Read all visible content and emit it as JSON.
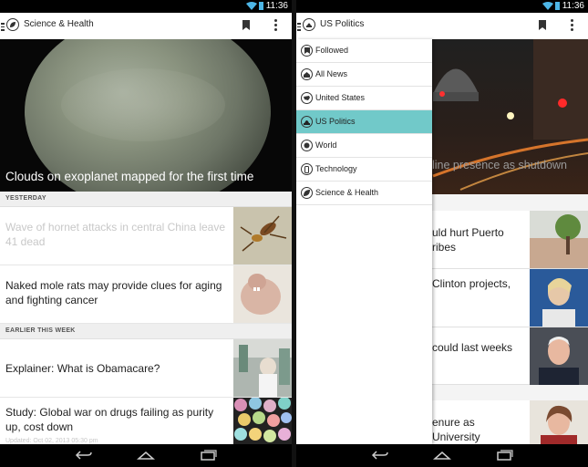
{
  "status": {
    "time": "11:36"
  },
  "left": {
    "appbar": {
      "title": "Science & Health"
    },
    "hero": {
      "caption": "Clouds on exoplanet mapped for the first time"
    },
    "sections": [
      "YESTERDAY",
      "EARLIER THIS WEEK"
    ],
    "stories": [
      {
        "headline": "Wave of hornet attacks in central China leave 41 dead",
        "read": true
      },
      {
        "headline": "Naked mole rats may provide clues for aging and fighting cancer",
        "read": false
      },
      {
        "headline": "Explainer: What is Obamacare?",
        "read": false
      },
      {
        "headline": "Study: Global war on drugs failing as purity up, cost down",
        "read": false,
        "meta": "Updated: Oct 02, 2013 05:30 pm"
      }
    ]
  },
  "right": {
    "appbar": {
      "title": "US Politics"
    },
    "drawer": {
      "items": [
        {
          "label": "Followed",
          "icon": "bookmark-icon"
        },
        {
          "label": "All News",
          "icon": "home-icon"
        },
        {
          "label": "United States",
          "icon": "us-map-icon"
        },
        {
          "label": "US Politics",
          "icon": "capitol-icon",
          "selected": true
        },
        {
          "label": "World",
          "icon": "globe-icon"
        },
        {
          "label": "Technology",
          "icon": "phone-icon"
        },
        {
          "label": "Science & Health",
          "icon": "leaf-icon"
        }
      ]
    },
    "background": {
      "caption": "line presence as shutdown",
      "items": [
        "uld hurt Puerto ribes",
        "Clinton projects,",
        "could last weeks",
        "enure as University"
      ]
    }
  },
  "colors": {
    "accent": "#71c9c9",
    "statusbar": "#000000"
  }
}
